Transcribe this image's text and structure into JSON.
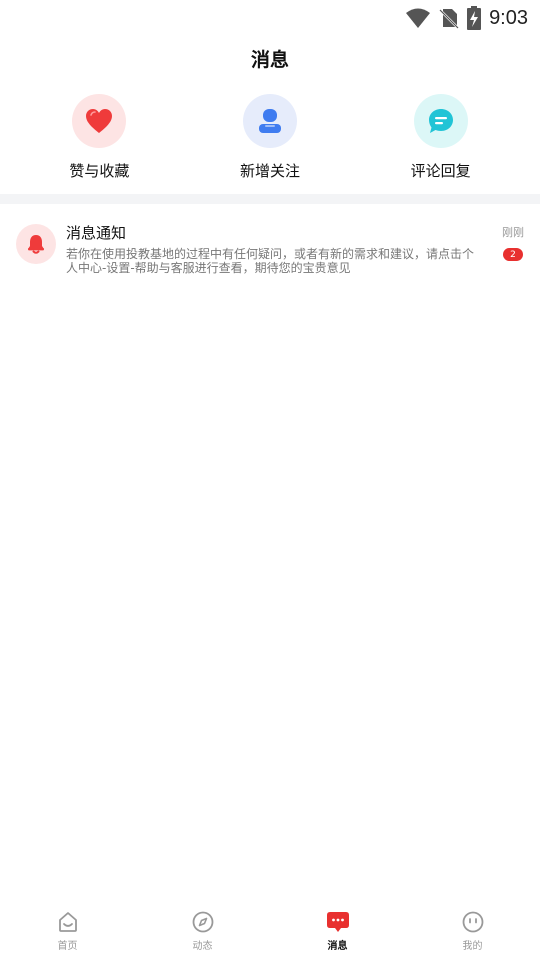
{
  "status_bar": {
    "time": "9:03",
    "icons": [
      "wifi-icon",
      "no-sim-icon",
      "battery-charging-icon"
    ]
  },
  "header": {
    "title": "消息"
  },
  "quick_actions": [
    {
      "label": "赞与收藏",
      "icon": "heart-icon",
      "color": "#ef3b3b"
    },
    {
      "label": "新增关注",
      "icon": "person-icon",
      "color": "#3f7cf0"
    },
    {
      "label": "评论回复",
      "icon": "chat-bubble-icon",
      "color": "#21c4d6"
    }
  ],
  "messages": [
    {
      "title": "消息通知",
      "preview": "若你在使用投教基地的过程中有任何疑问，或者有新的需求和建议，请点击个人中心-设置-帮助与客服进行查看，期待您的宝贵意见",
      "time": "刚刚",
      "badge": "2",
      "icon": "bell-icon"
    }
  ],
  "bottom_nav": [
    {
      "label": "首页",
      "icon": "home-icon",
      "active": false
    },
    {
      "label": "动态",
      "icon": "compass-icon",
      "active": false
    },
    {
      "label": "消息",
      "icon": "message-icon",
      "active": true
    },
    {
      "label": "我的",
      "icon": "face-icon",
      "active": false
    }
  ],
  "colors": {
    "accent": "#e8302f",
    "inactive": "#999999",
    "divider": "#f3f4f6"
  }
}
